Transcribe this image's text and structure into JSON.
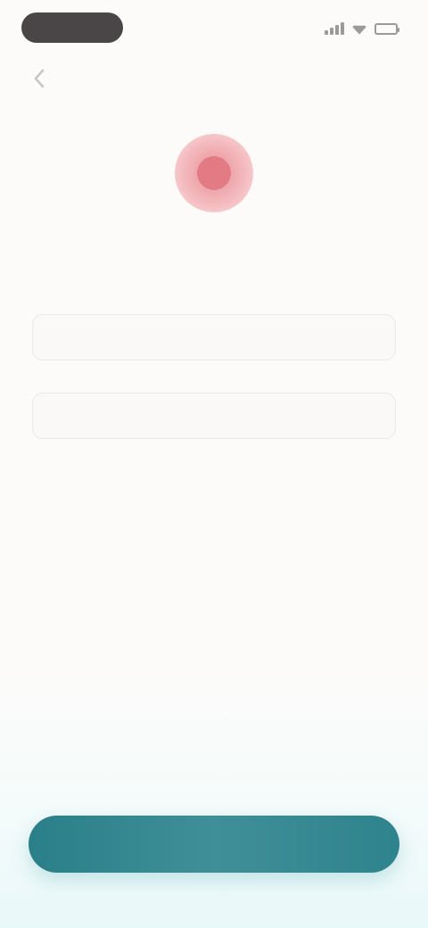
{
  "status_bar": {
    "time": "",
    "icons": [
      "signal-icon",
      "wifi-icon",
      "battery-icon"
    ]
  },
  "navigation": {
    "back_icon": "chevron-left-icon"
  },
  "logo": {
    "icon": "app-logo-icon",
    "color": "#e27b84"
  },
  "title": "",
  "form": {
    "field_one": {
      "value": "",
      "placeholder": ""
    },
    "field_two": {
      "value": "",
      "placeholder": ""
    }
  },
  "primary_button": {
    "label": "",
    "color": "#2a7f88"
  }
}
